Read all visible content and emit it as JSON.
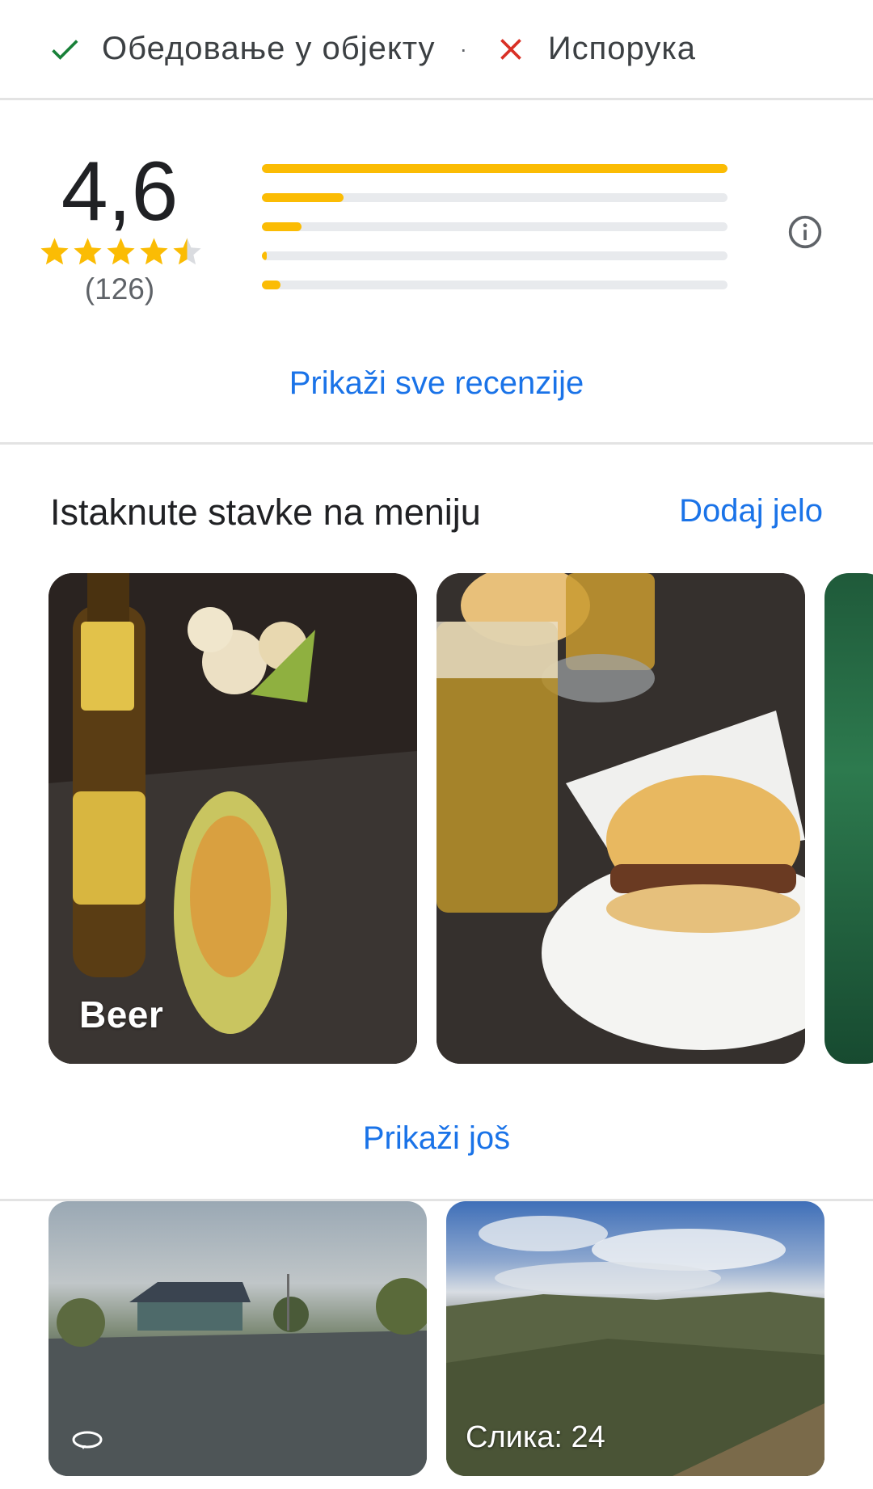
{
  "service_options": {
    "dine_in": {
      "label": "Обедовање у објекту",
      "available": true,
      "icon": "checkmark-icon"
    },
    "separator": "·",
    "delivery": {
      "label": "Испорука",
      "available": false,
      "icon": "close-icon"
    }
  },
  "rating": {
    "score": "4,6",
    "stars": 4.5,
    "count": "(126)",
    "distribution": [
      {
        "stars": 5,
        "fraction": 1.0
      },
      {
        "stars": 4,
        "fraction": 0.175
      },
      {
        "stars": 3,
        "fraction": 0.085
      },
      {
        "stars": 2,
        "fraction": 0.01
      },
      {
        "stars": 1,
        "fraction": 0.04
      }
    ],
    "show_all_label": "Prikaži sve recenzije",
    "info_icon": "info-icon"
  },
  "menu": {
    "title": "Istaknute stavke na meniju",
    "add_label": "Dodaj jelo",
    "items": [
      {
        "label": "Beer"
      },
      {
        "label": ""
      },
      {
        "label": ""
      }
    ],
    "show_more_label": "Prikaži još"
  },
  "photos": {
    "items": [
      {
        "type": "street-view",
        "icon": "street-view-icon"
      },
      {
        "type": "gallery",
        "count_label": "Слика: 24"
      }
    ]
  },
  "colors": {
    "accent": "#1a73e8",
    "star": "#fbbc04",
    "check": "#188038",
    "cross": "#d93025",
    "divider": "#e3e3e3"
  }
}
